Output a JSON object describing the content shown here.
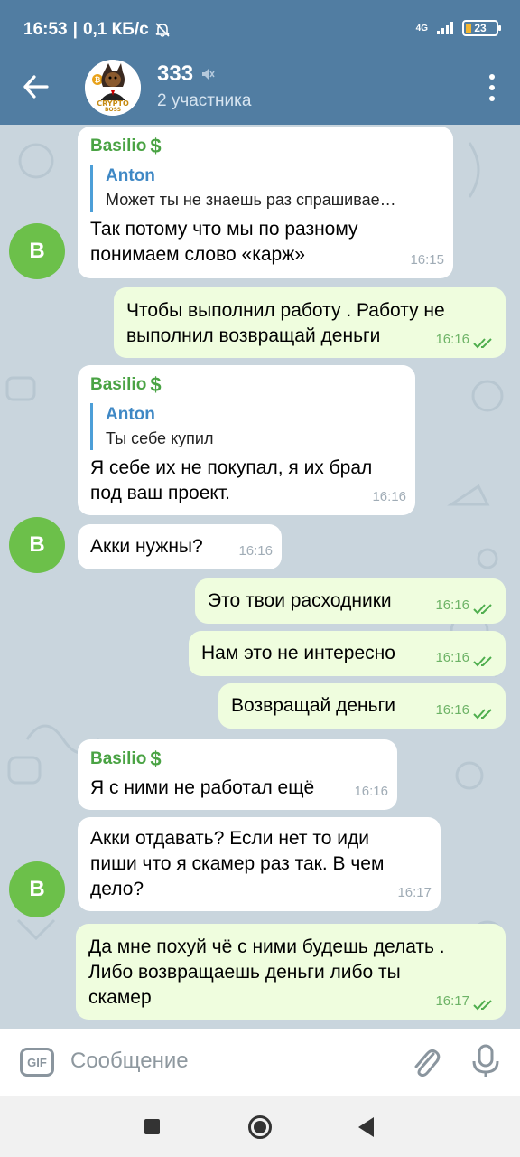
{
  "status": {
    "time": "16:53",
    "speed": "0,1 КБ/с",
    "network": "4G",
    "battery": "23"
  },
  "header": {
    "title": "333",
    "subtitle": "2 участника",
    "avatar_text_top": "CRYPTO",
    "avatar_text_bottom": "BOSS"
  },
  "colors": {
    "header": "#517da2",
    "incoming_bubble": "#ffffff",
    "outgoing_bubble": "#effdde",
    "sender_name": "#4aa344",
    "reply_name": "#3f88c5",
    "avatar_b": "#6cc04a"
  },
  "messages": [
    {
      "dir": "in",
      "sender": "Basilio",
      "sender_emoji": "$",
      "reply_name": "Anton",
      "reply_text": "Может ты не знаешь раз спрашивае…",
      "text": "Так потому что мы по разному\nпонимаем слово «карж»",
      "time": "16:15"
    },
    {
      "dir": "out",
      "text": "Чтобы выполнил работу . Работу не\nвыполнил возвращай деньги",
      "time": "16:16"
    },
    {
      "dir": "in",
      "sender": "Basilio",
      "sender_emoji": "$",
      "reply_name": "Anton",
      "reply_text": "Ты себе купил",
      "text": "Я себе их не покупал, я их брал\nпод ваш проект.",
      "time": "16:16"
    },
    {
      "dir": "in",
      "text": "Акки нужны?",
      "time": "16:16"
    },
    {
      "dir": "out",
      "text": "Это твои расходники",
      "time": "16:16"
    },
    {
      "dir": "out",
      "text": "Нам это не интересно",
      "time": "16:16"
    },
    {
      "dir": "out",
      "text": "Возвращай деньги",
      "time": "16:16"
    },
    {
      "dir": "in",
      "sender": "Basilio",
      "sender_emoji": "$",
      "text": "Я с ними не работал ещё",
      "time": "16:16"
    },
    {
      "dir": "in",
      "text": "Акки отдавать? Если нет то иди\nпиши что я скамер раз так. В чем\nдело?",
      "time": "16:17"
    },
    {
      "dir": "out",
      "text": "Да мне похуй чё с ними будешь делать .\nЛибо возвращаешь деньги либо ты\nскамер",
      "time": "16:17"
    }
  ],
  "sender_avatar_letter": "B",
  "input": {
    "gif_label": "GIF",
    "placeholder": "Сообщение"
  }
}
